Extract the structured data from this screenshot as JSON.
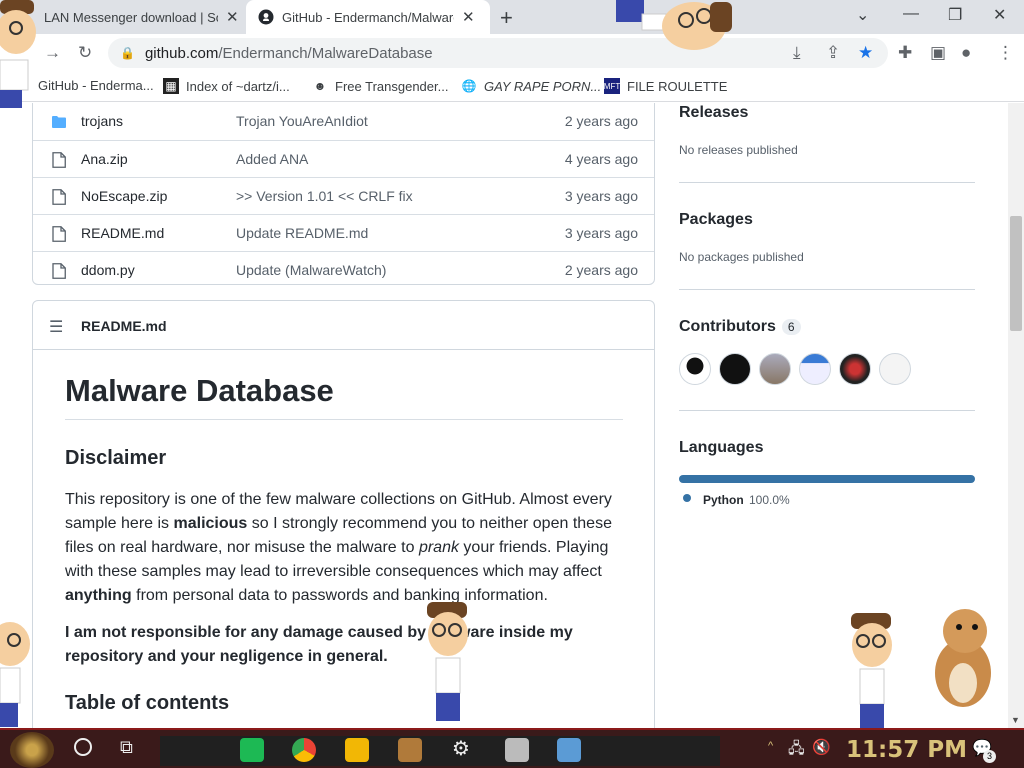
{
  "browser": {
    "tabs": [
      {
        "title": "LAN Messenger download | So",
        "active": false
      },
      {
        "title": "GitHub - Endermanch/Malware",
        "active": true
      }
    ],
    "url_domain": "github.com",
    "url_path": "/Endermanch/MalwareDatabase",
    "bookmarks": [
      "GitHub - Enderma...",
      "Index of ~dartz/i...",
      "Free Transgender...",
      "GAY RAPE PORN...",
      "FILE ROULETTE"
    ]
  },
  "files": [
    {
      "name": "trojans",
      "type": "folder",
      "message": "Trojan YouAreAnIdiot",
      "age": "2 years ago"
    },
    {
      "name": "Ana.zip",
      "type": "file",
      "message": "Added ANA",
      "age": "4 years ago"
    },
    {
      "name": "NoEscape.zip",
      "type": "file",
      "message": ">> Version 1.01 << CRLF fix",
      "age": "3 years ago"
    },
    {
      "name": "README.md",
      "type": "file",
      "message": "Update README.md",
      "age": "3 years ago"
    },
    {
      "name": "ddom.py",
      "type": "file",
      "message": "Update (MalwareWatch)",
      "age": "2 years ago"
    }
  ],
  "readme": {
    "filename": "README.md",
    "h1": "Malware Database",
    "disclaimer_heading": "Disclaimer",
    "p1_a": "This repository is one of the few malware collections on GitHub. Almost every sample here is ",
    "p1_b": "malicious",
    "p1_c": " so I strongly recommend you to neither open these files on real hardware, nor misuse the malware to ",
    "p1_d": "prank",
    "p1_e": " your friends. Playing with these samples may lead to irreversible consequences which may affect ",
    "p1_f": "anything",
    "p1_g": " from personal data to passwords and banking information.",
    "p2": "I am not responsible for any damage caused by malware inside my repository and your negligence in general.",
    "toc_heading": "Table of contents"
  },
  "sidebar": {
    "releases_heading": "Releases",
    "releases_text": "No releases published",
    "packages_heading": "Packages",
    "packages_text": "No packages published",
    "contributors_heading": "Contributors",
    "contributors_count": "6",
    "languages_heading": "Languages",
    "language_name": "Python",
    "language_pct": "100.0%",
    "language_color": "#3572a5"
  },
  "taskbar": {
    "clock": "11:57 PM",
    "notif_count": "3"
  }
}
